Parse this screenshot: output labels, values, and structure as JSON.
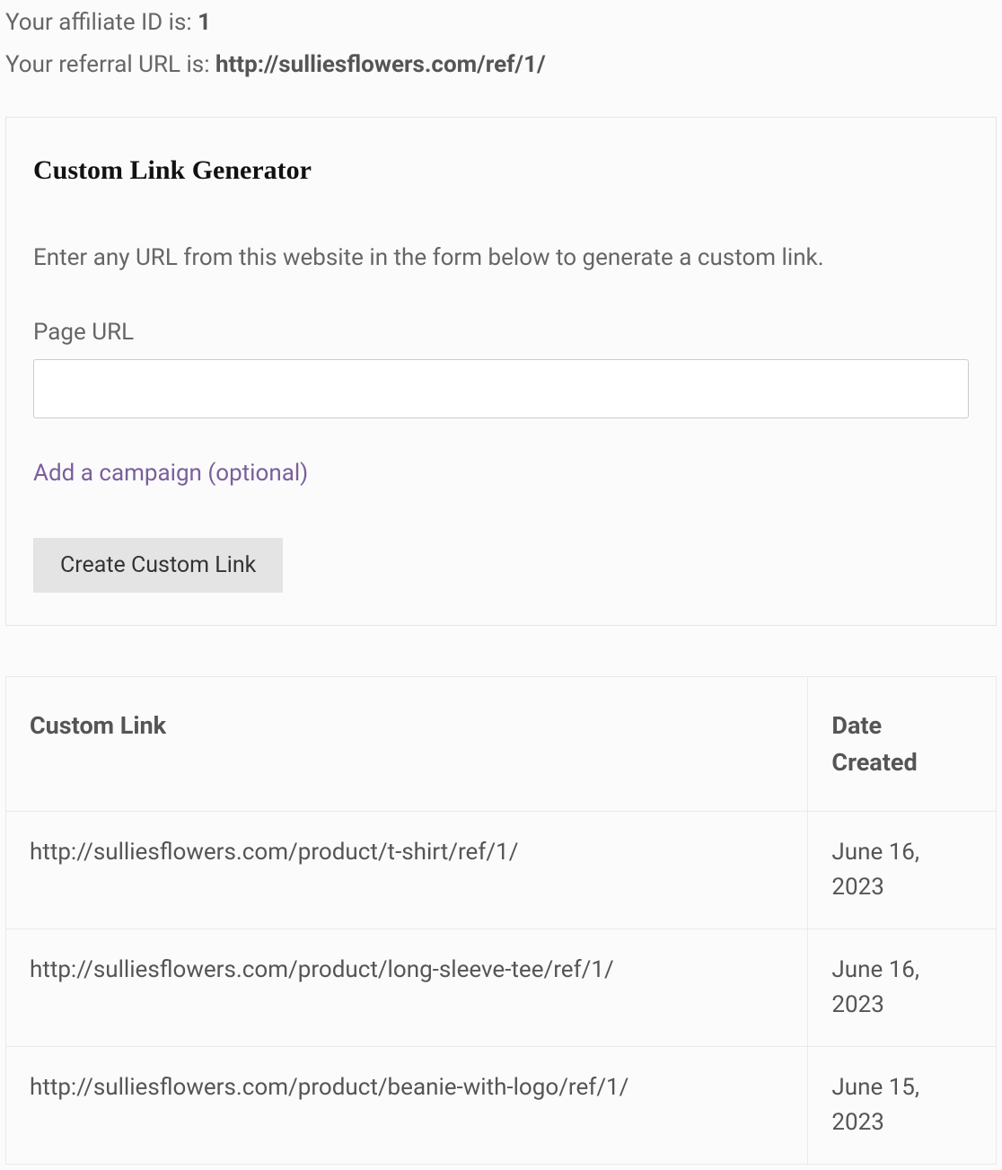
{
  "affiliate": {
    "id_label": "Your affiliate ID is: ",
    "id_value": "1",
    "url_label": "Your referral URL is: ",
    "url_value": "http://sulliesflowers.com/ref/1/"
  },
  "generator": {
    "title": "Custom Link Generator",
    "description": "Enter any URL from this website in the form below to generate a custom link.",
    "field_label": "Page URL",
    "input_value": "",
    "campaign_link": "Add a campaign (optional)",
    "button_label": "Create Custom Link"
  },
  "table": {
    "headers": {
      "link": "Custom Link",
      "date": "Date Created"
    },
    "rows": [
      {
        "link": "http://sulliesflowers.com/product/t-shirt/ref/1/",
        "date": "June 16, 2023"
      },
      {
        "link": "http://sulliesflowers.com/product/long-sleeve-tee/ref/1/",
        "date": "June 16, 2023"
      },
      {
        "link": "http://sulliesflowers.com/product/beanie-with-logo/ref/1/",
        "date": "June 15, 2023"
      }
    ]
  }
}
